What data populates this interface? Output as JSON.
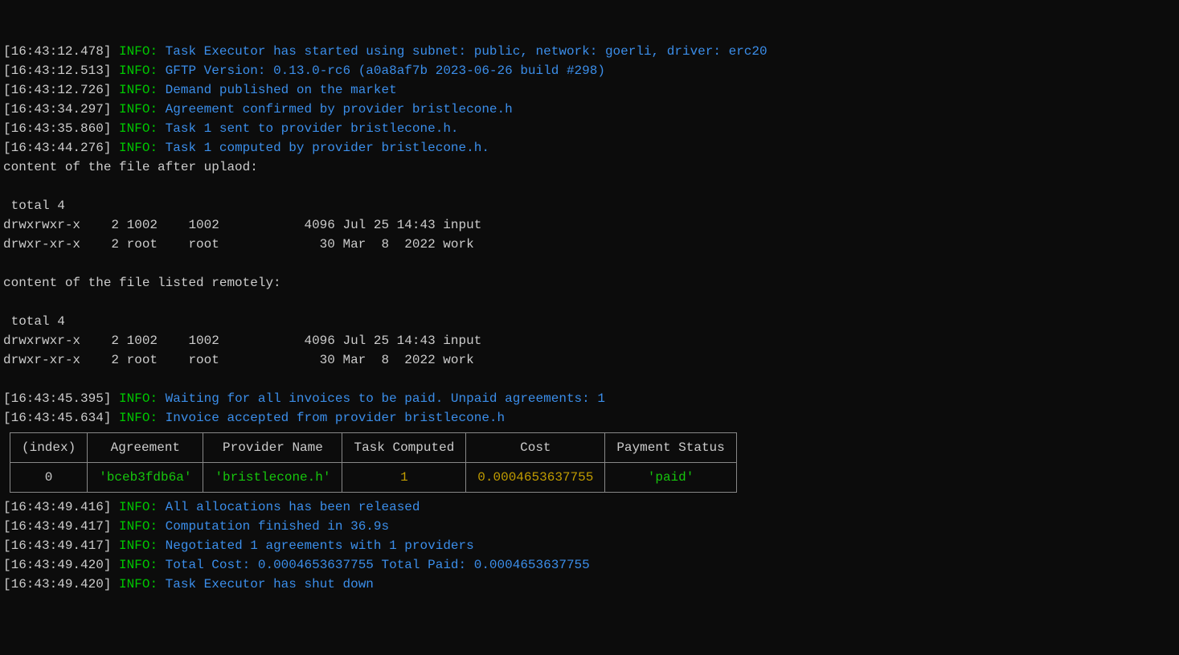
{
  "logs": [
    {
      "ts": "[16:43:12.478]",
      "level": "INFO",
      "msg": "Task Executor has started using subnet: public, network: goerli, driver: erc20"
    },
    {
      "ts": "[16:43:12.513]",
      "level": "INFO",
      "msg": "GFTP Version: 0.13.0-rc6 (a0a8af7b 2023-06-26 build #298)"
    },
    {
      "ts": "[16:43:12.726]",
      "level": "INFO",
      "msg": "Demand published on the market"
    },
    {
      "ts": "[16:43:34.297]",
      "level": "INFO",
      "msg": "Agreement confirmed by provider bristlecone.h"
    },
    {
      "ts": "[16:43:35.860]",
      "level": "INFO",
      "msg": "Task 1 sent to provider bristlecone.h."
    },
    {
      "ts": "[16:43:44.276]",
      "level": "INFO",
      "msg": "Task 1 computed by provider bristlecone.h."
    }
  ],
  "plain1": "content of the file after uplaod:",
  "ls1": {
    "total": " total 4",
    "r1": "drwxrwxr-x    2 1002    1002           4096 Jul 25 14:43 input",
    "r2": "drwxr-xr-x    2 root    root             30 Mar  8  2022 work"
  },
  "plain2": "content of the file listed remotely:",
  "ls2": {
    "total": " total 4",
    "r1": "drwxrwxr-x    2 1002    1002           4096 Jul 25 14:43 input",
    "r2": "drwxr-xr-x    2 root    root             30 Mar  8  2022 work"
  },
  "logs2": [
    {
      "ts": "[16:43:45.395]",
      "level": "INFO",
      "msg": "Waiting for all invoices to be paid. Unpaid agreements: 1"
    },
    {
      "ts": "[16:43:45.634]",
      "level": "INFO",
      "msg": "Invoice accepted from provider bristlecone.h"
    }
  ],
  "table": {
    "headers": [
      "(index)",
      "Agreement",
      "Provider Name",
      "Task Computed",
      "Cost",
      "Payment Status"
    ],
    "row": {
      "index": "0",
      "agreement": "'bceb3fdb6a'",
      "provider": "'bristlecone.h'",
      "task": "1",
      "cost": "0.0004653637755",
      "status": "'paid'"
    }
  },
  "logs3": [
    {
      "ts": "[16:43:49.416]",
      "level": "INFO",
      "msg": "All allocations has been released"
    },
    {
      "ts": "[16:43:49.417]",
      "level": "INFO",
      "msg": "Computation finished in 36.9s"
    },
    {
      "ts": "[16:43:49.417]",
      "level": "INFO",
      "msg": "Negotiated 1 agreements with 1 providers"
    },
    {
      "ts": "[16:43:49.420]",
      "level": "INFO",
      "msg": "Total Cost: 0.0004653637755 Total Paid: 0.0004653637755"
    },
    {
      "ts": "[16:43:49.420]",
      "level": "INFO",
      "msg": "Task Executor has shut down"
    }
  ]
}
